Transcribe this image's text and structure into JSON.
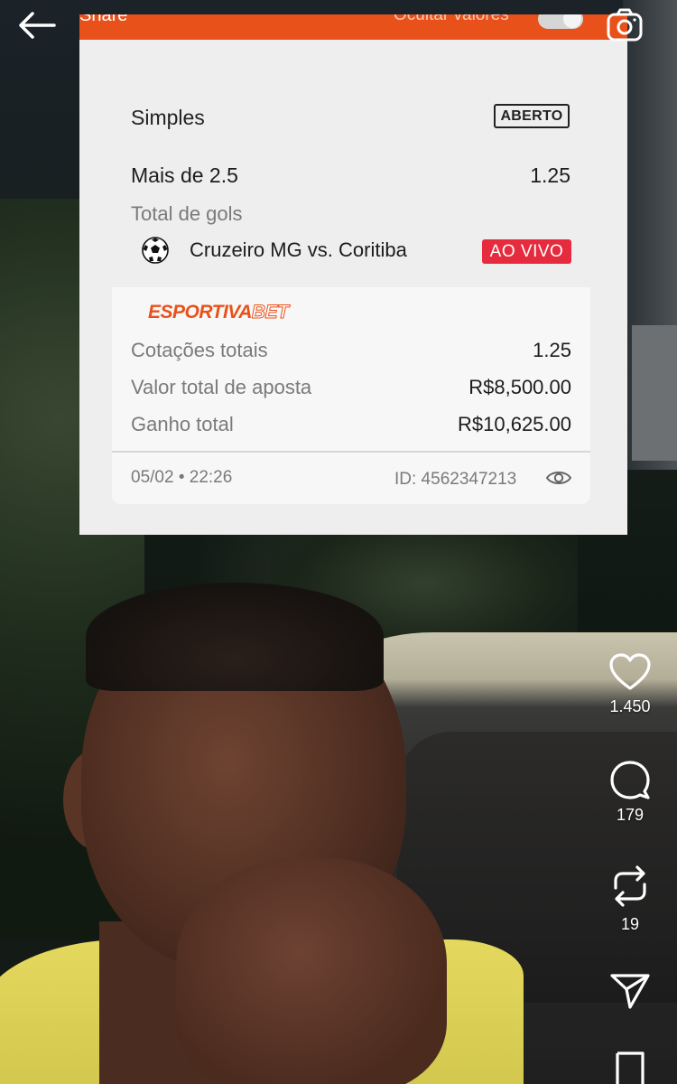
{
  "background": {
    "description_icon": "video-frame"
  },
  "top_bar": {
    "back_icon": "arrow-left-icon",
    "camera_icon": "camera-icon"
  },
  "slip": {
    "header": {
      "share_label": "Share",
      "hide_values_label": "Ocultar valores",
      "accent_color": "#e9511b"
    },
    "bet_type": "Simples",
    "status": "ABERTO",
    "selection": "Mais de 2.5",
    "selection_odd": "1.25",
    "market": "Total de gols",
    "match": "Cruzeiro MG vs. Coritiba",
    "live_badge": "AO VIVO",
    "live_color": "#e52b3d",
    "brand_part1": "ESPORTIVA",
    "brand_part2": "BET",
    "summary": [
      {
        "label": "Cotações totais",
        "value": "1.25"
      },
      {
        "label": "Valor total de aposta",
        "value": "R$8,500.00"
      },
      {
        "label": "Ganho total",
        "value": "R$10,625.00"
      }
    ],
    "date": "05/02 • 22:26",
    "id_text": "ID:  4562347213"
  },
  "actions": {
    "likes": "1.450",
    "comments": "179",
    "reposts": "19"
  }
}
